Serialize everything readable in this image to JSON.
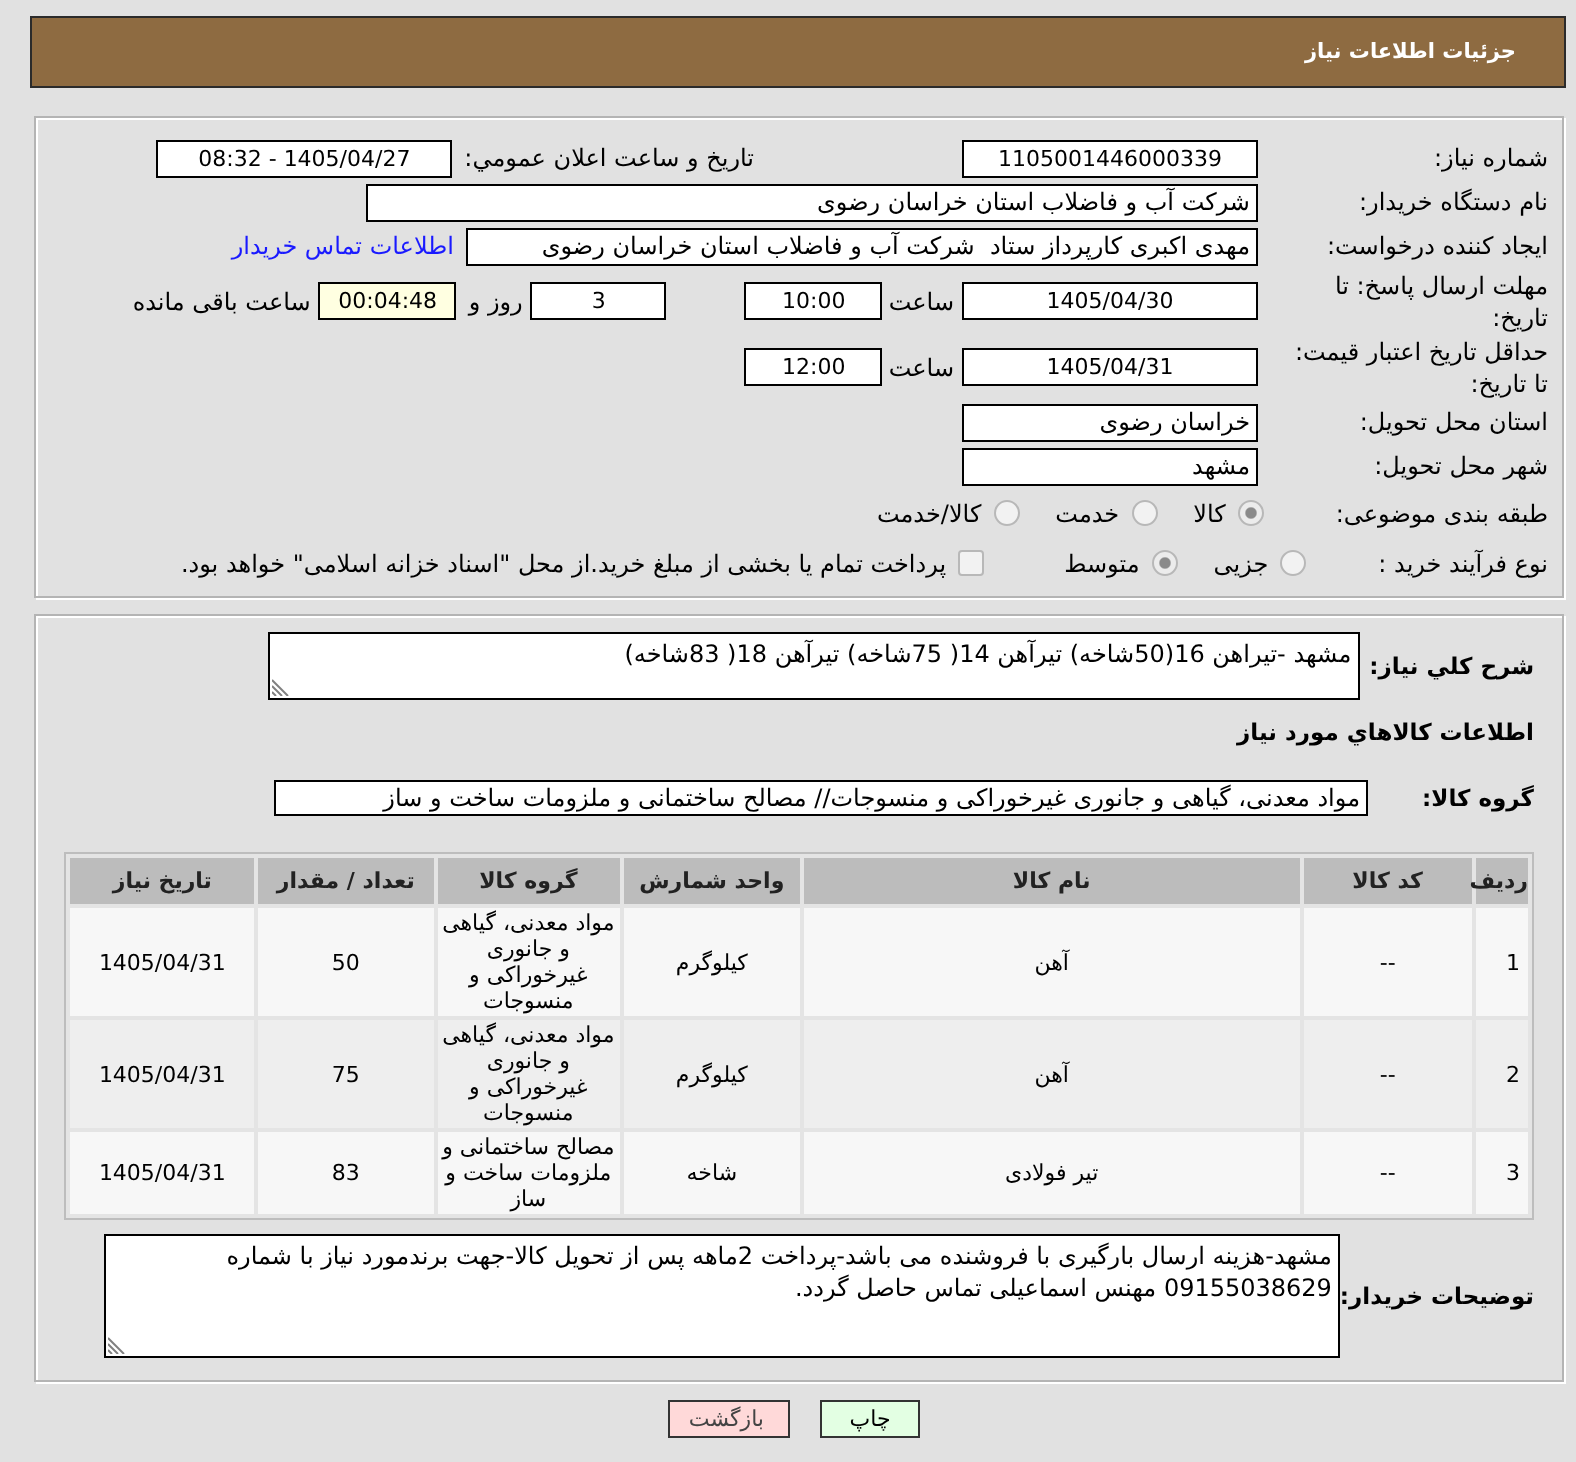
{
  "header": {
    "title": "جزئیات اطلاعات نیاز"
  },
  "details": {
    "need_number": {
      "label": "شماره نیاز:",
      "value": "1105001446000339"
    },
    "announcement": {
      "label": "تاریخ و ساعت اعلان عمومي:",
      "value": "1405/04/27 - 08:32"
    },
    "buyer_org": {
      "label": "نام دستگاه خریدار:",
      "value": "شرکت آب و فاضلاب استان خراسان رضوی"
    },
    "requester": {
      "label": "ایجاد کننده درخواست:",
      "value": "مهدی اکبری کارپرداز ستاد  شرکت آب و فاضلاب استان خراسان رضوی",
      "link": "اطلاعات تماس خریدار"
    },
    "reply_deadline": {
      "label": "مهلت ارسال پاسخ: تا تاریخ:",
      "date": "1405/04/30",
      "time_label": "ساعت",
      "time": "10:00",
      "days": "3",
      "days_label": "روز و",
      "remaining": "00:04:48",
      "remaining_label": "ساعت باقی مانده"
    },
    "price_validity": {
      "label": "حداقل تاریخ اعتبار قیمت: تا تاریخ:",
      "date": "1405/04/31",
      "time_label": "ساعت",
      "time": "12:00"
    },
    "province": {
      "label": "استان محل تحویل:",
      "value": "خراسان رضوی"
    },
    "city": {
      "label": "شهر محل تحویل:",
      "value": "مشهد"
    },
    "category": {
      "label": "طبقه بندی موضوعی:",
      "options": [
        {
          "label": "کالا",
          "selected": true
        },
        {
          "label": "خدمت",
          "selected": false
        },
        {
          "label": "کالا/خدمت",
          "selected": false
        }
      ]
    },
    "purchase_type": {
      "label": "نوع فرآیند خرید :",
      "options": [
        {
          "label": "جزیی",
          "selected": false
        },
        {
          "label": "متوسط",
          "selected": true
        }
      ],
      "treasury": {
        "label": "پرداخت تمام یا بخشی از مبلغ خرید.از محل \"اسناد خزانه اسلامی\" خواهد بود.",
        "checked": false
      }
    }
  },
  "summary": {
    "label": "شرح كلي نياز:",
    "value": "مشهد -تیراهن 16(50شاخه) تیرآهن 14( 75شاخه) تیرآهن 18( 83شاخه)"
  },
  "goods": {
    "title": "اطلاعات كالاهاي مورد نياز",
    "group_label": "گروه کالا:",
    "group": "مواد معدنی، گیاهی و جانوری غیرخوراکی و منسوجات// مصالح ساختمانی و ملزومات ساخت و ساز",
    "table": {
      "columns": [
        "ردیف",
        "کد کالا",
        "نام کالا",
        "واحد شمارش",
        "گروه کالا",
        "تعداد / مقدار",
        "تاریخ نیاز"
      ],
      "rows": [
        [
          "1",
          "--",
          "آهن",
          "کیلوگرم",
          "مواد معدنی، گیاهی و جانوری غیرخوراکی و منسوجات",
          "50",
          "1405/04/31"
        ],
        [
          "2",
          "--",
          "آهن",
          "کیلوگرم",
          "مواد معدنی، گیاهی و جانوری غیرخوراکی و منسوجات",
          "75",
          "1405/04/31"
        ],
        [
          "3",
          "--",
          "تیر فولادی",
          "شاخه",
          "مصالح ساختمانی و ملزومات ساخت و ساز",
          "83",
          "1405/04/31"
        ]
      ]
    }
  },
  "notes": {
    "label": "توضیحات خریدار:",
    "value": "مشهد-هزینه ارسال بارگیری با فروشنده می باشد-پرداخت 2ماهه پس از تحویل کالا-جهت برندمورد نیاز با شماره 09155038629 مهنس اسماعیلی تماس حاصل گردد."
  },
  "buttons": [
    {
      "label": "چاپ",
      "kind": "print"
    },
    {
      "label": "بازگشت",
      "kind": "back"
    }
  ]
}
